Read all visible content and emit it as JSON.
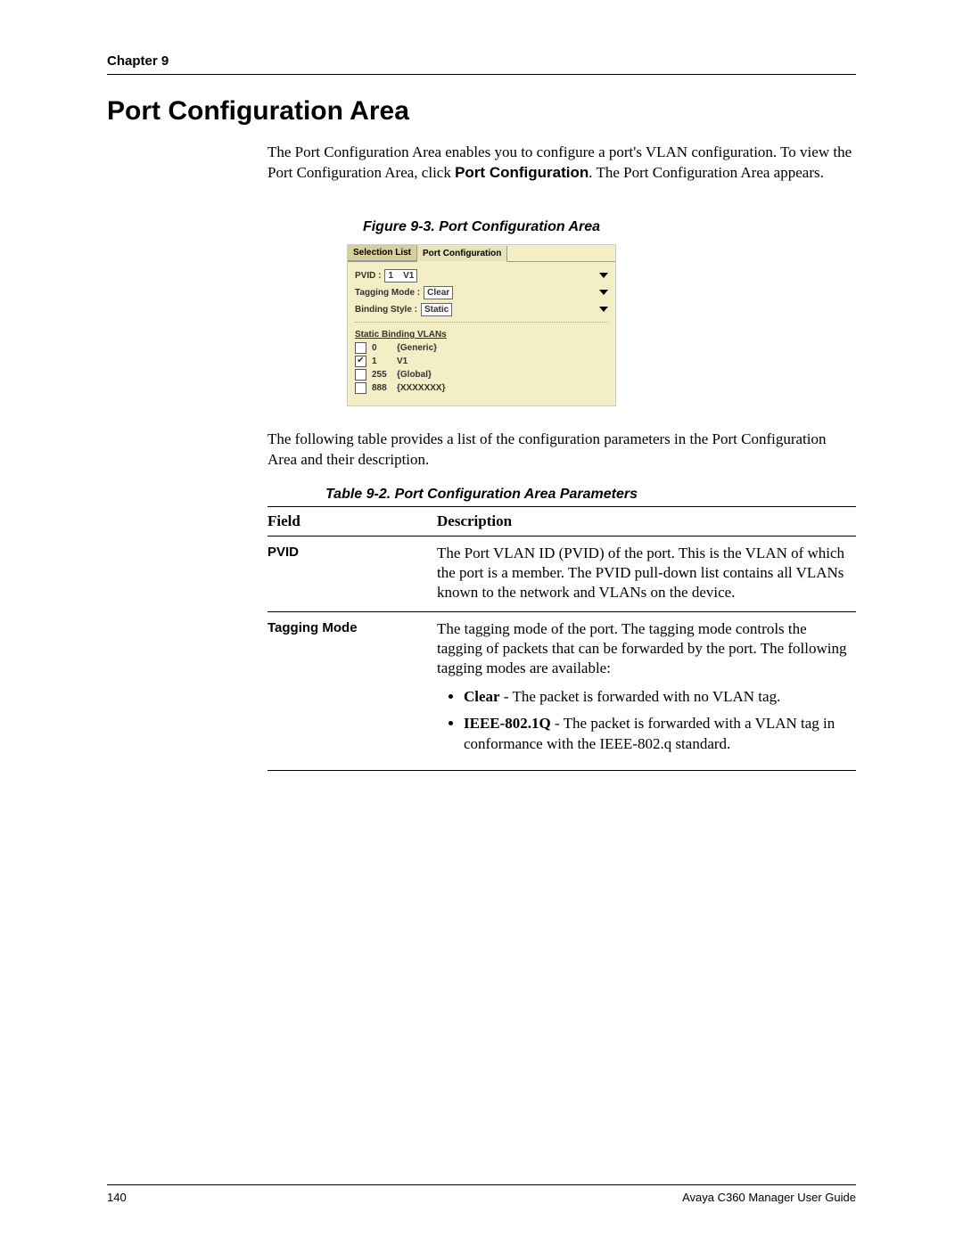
{
  "header": {
    "chapter": "Chapter 9"
  },
  "title": "Port Configuration Area",
  "intro": {
    "p1a": "The Port Configuration Area enables you to configure a port's VLAN configuration. To view the Port Configuration Area, click ",
    "bold": "Port Configuration",
    "p1b": ". The Port Configuration Area appears."
  },
  "figure": {
    "caption": "Figure 9-3. Port Configuration Area",
    "tabs": {
      "left": "Selection List",
      "right": "Port Configuration"
    },
    "pvid_label": "PVID :",
    "pvid_value": "1    V1",
    "tagging_label": "Tagging Mode :",
    "tagging_value": "Clear",
    "binding_label": "Binding Style :",
    "binding_value": "Static",
    "static_header": "Static Binding VLANs",
    "rows": [
      {
        "checked": false,
        "id": "0",
        "name": "{Generic}"
      },
      {
        "checked": true,
        "id": "1",
        "name": "V1"
      },
      {
        "checked": false,
        "id": "255",
        "name": "{Global}"
      },
      {
        "checked": false,
        "id": "888",
        "name": "{XXXXXXX}"
      }
    ]
  },
  "after_figure": "The following table provides a list of the configuration parameters in the Port Configuration Area and their description.",
  "table": {
    "caption": "Table 9-2. Port Configuration Area Parameters",
    "head_field": "Field",
    "head_desc": "Description",
    "rows": [
      {
        "field": "PVID",
        "desc": "The Port VLAN ID (PVID) of the port. This is the VLAN of which the port is a member. The PVID pull-down list contains all VLANs known to the network and VLANs on the device."
      },
      {
        "field": "Tagging Mode",
        "desc": "The tagging mode of the port. The tagging mode controls the tagging of packets that can be forwarded by the port. The following tagging modes are available:",
        "bullets": [
          {
            "b": "Clear",
            "t": " - The packet is forwarded with no VLAN tag."
          },
          {
            "b": "IEEE-802.1Q",
            "t": " - The packet is forwarded with a VLAN tag in conformance with the IEEE-802.q standard."
          }
        ]
      }
    ]
  },
  "footer": {
    "page": "140",
    "guide": "Avaya C360 Manager User Guide"
  }
}
